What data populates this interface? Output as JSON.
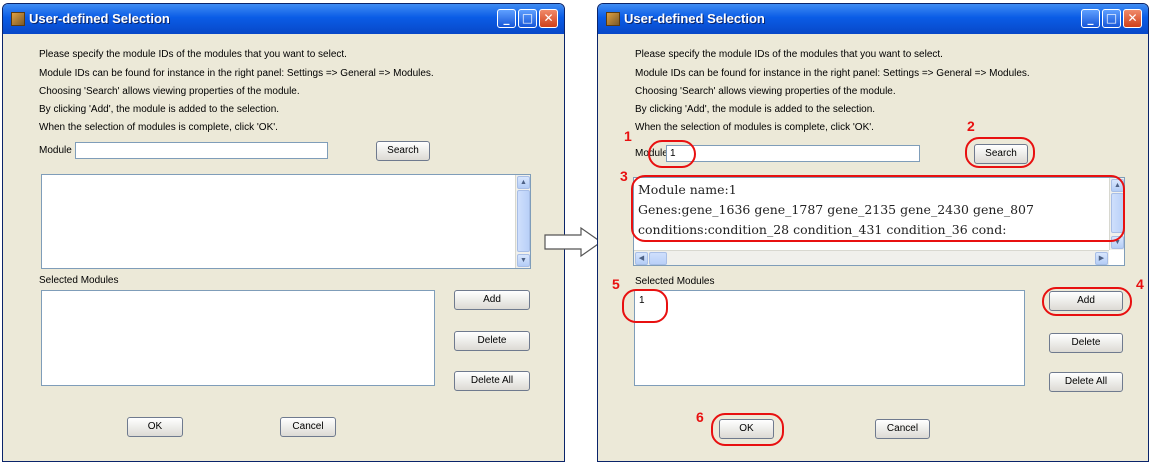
{
  "window": {
    "title": "User-defined Selection",
    "minimize_glyph": "_",
    "maximize_glyph": "□",
    "close_glyph": "✕"
  },
  "instructions": [
    "Please specify the module IDs of the modules that you want to select.",
    "Module IDs can be found for instance in the right panel: Settings => General => Modules.",
    "Choosing 'Search' allows viewing properties of the module.",
    "By clicking 'Add', the module is added to the selection.",
    "When the selection of modules is complete, click 'OK'."
  ],
  "labels": {
    "module": "Module",
    "selected_modules": "Selected Modules"
  },
  "buttons": {
    "search": "Search",
    "add": "Add",
    "delete": "Delete",
    "delete_all": "Delete All",
    "ok": "OK",
    "cancel": "Cancel"
  },
  "left": {
    "module_value": "",
    "result_lines": [],
    "selected_items": []
  },
  "right": {
    "module_value": "1",
    "result_lines": [
      "Module name:1",
      "Genes:gene_1636 gene_1787 gene_2135 gene_2430 gene_807",
      "conditions:condition_28 condition_431 condition_36 cond:"
    ],
    "selected_items": [
      "1"
    ]
  },
  "callout_numbers": [
    "1",
    "2",
    "3",
    "4",
    "5",
    "6"
  ],
  "colors": {
    "title_bar": "#0a5ce6",
    "dialog_bg": "#ece9d8",
    "callout": "#e81010"
  }
}
